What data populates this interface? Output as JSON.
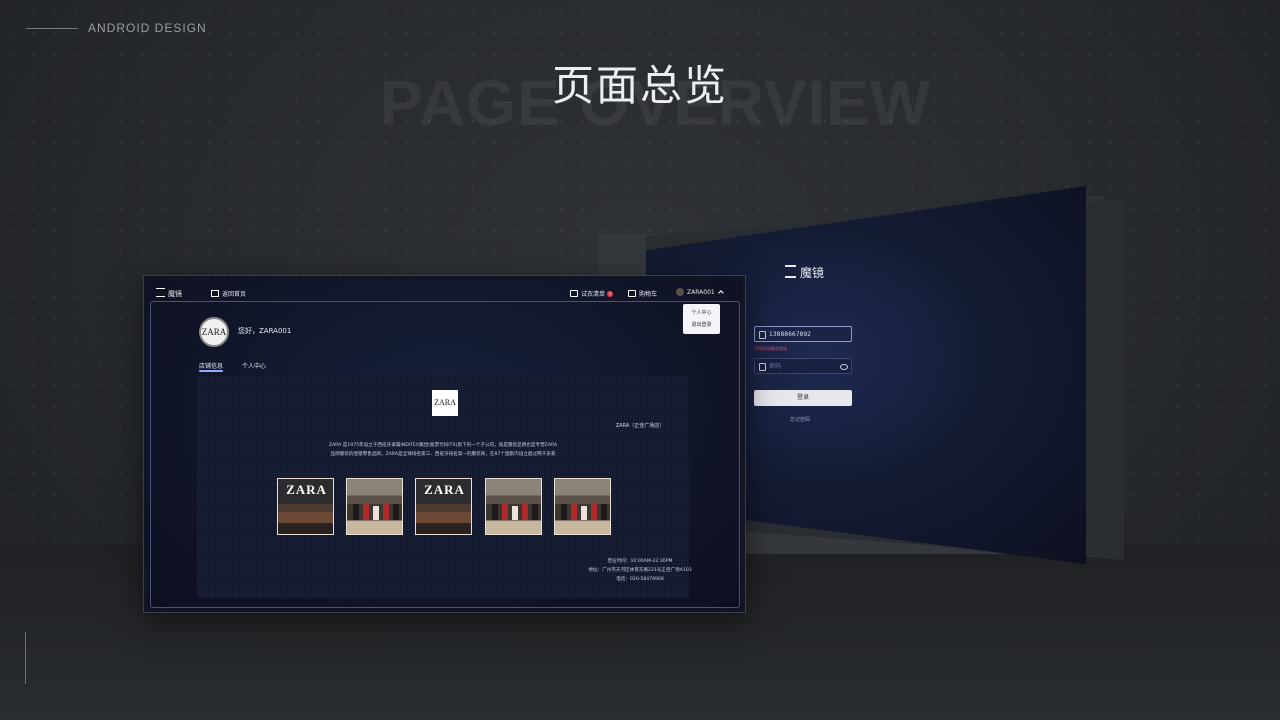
{
  "header": {
    "corner_label": "ANDROID DESIGN",
    "title": "页面总览",
    "bg_title": "PAGE OVERVIEW"
  },
  "login": {
    "logo_text": "魔镜",
    "phone_value": "13888667892",
    "error_text": "手机号码格式错误",
    "password_placeholder": "密码",
    "login_button": "登录",
    "forgot_link": "忘记密码"
  },
  "app": {
    "logo_text": "魔镜",
    "nav_home": "返回首页",
    "fitting_list": "试衣清单",
    "fitting_badge": "1",
    "cart": "购物车",
    "user_name": "ZARA001",
    "dropdown": [
      "个人中心",
      "退出登录"
    ],
    "greeting": "您好，ZARA001",
    "tabs": [
      "店铺信息",
      "个人中心"
    ],
    "store": {
      "logo": "ZARA",
      "name": "ZARA（正佳广场店）",
      "desc_line1": "ZARA 是1975年设立于西班牙隶属INDITEX集团(股票代码ITX)旗下的一个子公司，既是服装品牌也是专营ZARA",
      "desc_line2": "品牌服装的连锁零售品牌。ZARA是全球排名第三、西班牙排名第一的服装商，在87个国家内设立超过两千多家",
      "photo_text": "ZARA",
      "hours": "营业时间：10:00AM-22:30PM",
      "address": "地址：广州市天河区体育东路221号正佳广场A103",
      "phone": "电话：020-58478968"
    }
  }
}
